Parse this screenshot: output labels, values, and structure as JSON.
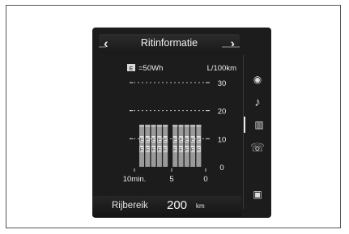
{
  "header": {
    "title": "Ritinformatie",
    "prev_icon": "chevron-left",
    "next_icon": "chevron-right"
  },
  "legend": {
    "box_label": "E",
    "text": "=50Wh",
    "unit": "L/100km"
  },
  "chart_data": {
    "type": "bar",
    "title": "",
    "xlabel": "",
    "ylabel": "L/100km",
    "ylim": [
      0,
      30
    ],
    "x_ticks": [
      "10min.",
      "5",
      "0"
    ],
    "y_ticks": [
      "30",
      "20",
      "10",
      "0"
    ],
    "values": [
      15,
      15,
      15,
      15,
      15,
      15,
      15,
      15,
      15,
      15
    ],
    "energy_marks": [
      [
        "E",
        "E",
        "E",
        "E",
        "E",
        "E",
        "E",
        "E",
        "E",
        "E"
      ],
      [
        "E",
        "E",
        "E",
        "E",
        "E",
        "E",
        "E",
        "E",
        "E",
        "E"
      ]
    ]
  },
  "sidebar": {
    "items": [
      {
        "icon": "navigation-icon",
        "glyph": "◉"
      },
      {
        "icon": "music-note-icon",
        "glyph": "♪"
      },
      {
        "icon": "bar-chart-icon",
        "glyph": "▥",
        "selected": true
      },
      {
        "icon": "phone-icon",
        "glyph": "☏"
      },
      {
        "icon": "media-icon",
        "glyph": "▣"
      }
    ]
  },
  "footer": {
    "label": "Rijbereik",
    "value": "200",
    "unit": "km"
  },
  "colors": {
    "screen_bg": "#1c1c1c",
    "bar": "#9a9a9a",
    "text": "#ececec"
  }
}
